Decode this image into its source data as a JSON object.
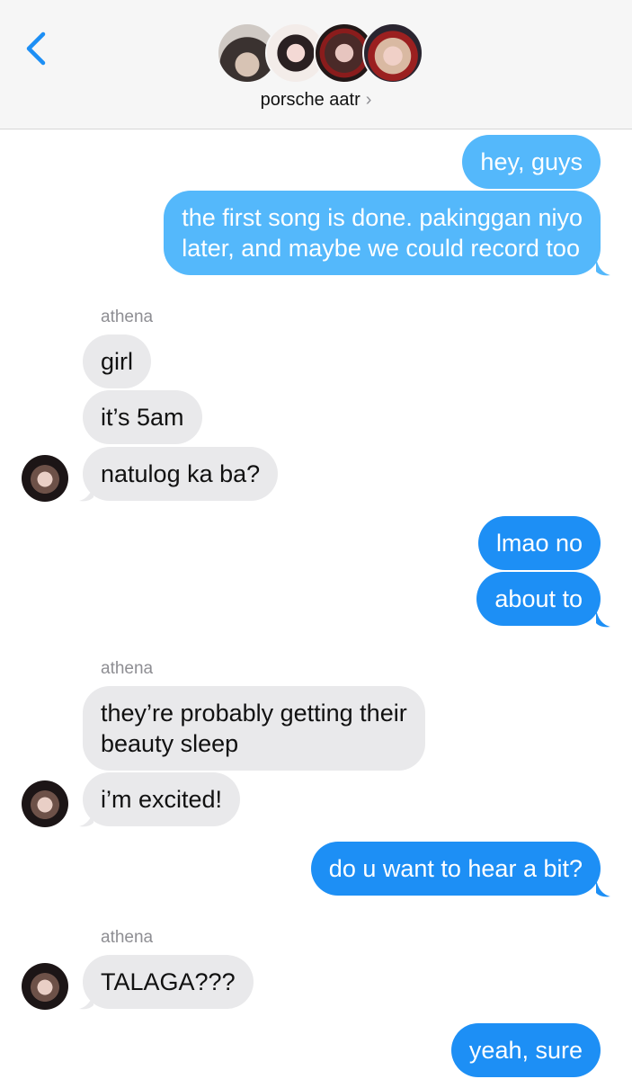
{
  "header": {
    "back_icon": "chevron-left-icon",
    "group_name": "porsche aatr",
    "chevron": "›",
    "accent_color": "#1d8ff5"
  },
  "messages": [
    {
      "id": "m1",
      "type": "outgoing",
      "text": "hey, guys"
    },
    {
      "id": "m2",
      "type": "outgoing",
      "lines": [
        "the first song is done. pakinggan niyo",
        "later, and maybe we could record too"
      ]
    },
    {
      "id": "s1",
      "type": "sender",
      "text": "athena"
    },
    {
      "id": "m3",
      "type": "incoming",
      "text": "girl"
    },
    {
      "id": "m4",
      "type": "incoming",
      "text": "it’s 5am"
    },
    {
      "id": "m5",
      "type": "incoming",
      "text": "natulog ka ba?"
    },
    {
      "id": "m6",
      "type": "outgoing",
      "text": "lmao no"
    },
    {
      "id": "m7",
      "type": "outgoing",
      "text": "about to"
    },
    {
      "id": "s2",
      "type": "sender",
      "text": "athena"
    },
    {
      "id": "m8",
      "type": "incoming",
      "lines": [
        "they’re probably getting their",
        "beauty sleep"
      ]
    },
    {
      "id": "m9",
      "type": "incoming",
      "text": "i’m excited!"
    },
    {
      "id": "m10",
      "type": "outgoing",
      "text": "do u want to hear a bit?"
    },
    {
      "id": "s3",
      "type": "sender",
      "text": "athena"
    },
    {
      "id": "m11",
      "type": "incoming",
      "text": "TALAGA???"
    },
    {
      "id": "m12",
      "type": "outgoing",
      "text": "yeah, sure"
    }
  ],
  "colors": {
    "outgoing_bubble": "#1d8ff5",
    "outgoing_bubble_light": "#54b8fb",
    "incoming_bubble": "#e9e9eb",
    "header_bg": "#f6f6f6"
  }
}
